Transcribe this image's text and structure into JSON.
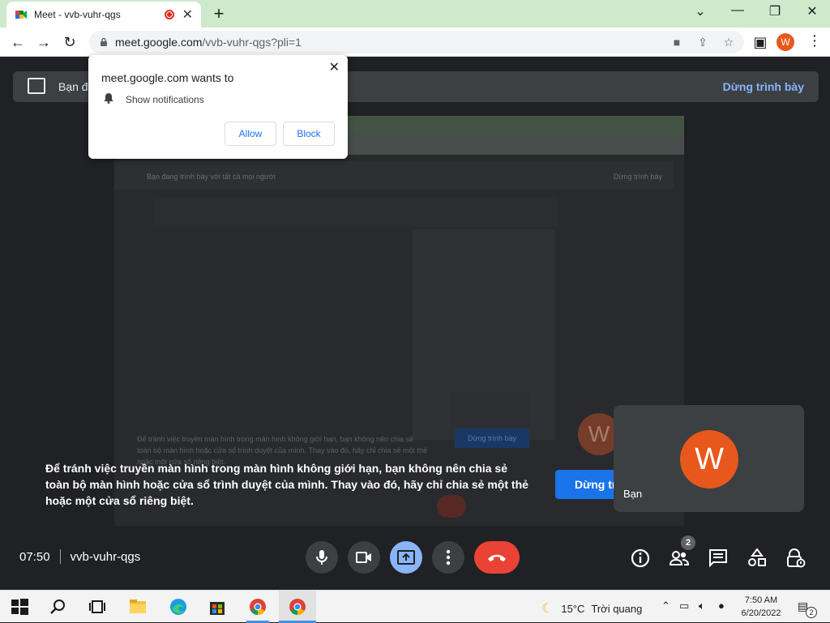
{
  "browser": {
    "tab_title": "Meet - vvb-vuhr-qgs",
    "url_host": "meet.google.com",
    "url_path": "/vvb-vuhr-qgs?pli=1",
    "profile_initial": "W"
  },
  "banner": {
    "text": "Bạn đ",
    "stop_label": "Dừng trình bày"
  },
  "mirror": {
    "banner_text": "Bạn đang trình bày với tất cả mọi người",
    "banner_stop": "Dừng trình bày",
    "message": "Để tránh việc truyền màn hình trong màn hình không giới hạn, bạn không nên chia sẻ toàn bộ màn hình hoặc cửa sổ trình duyệt của mình. Thay vào đó, hãy chỉ chia sẻ một thẻ hoặc một cửa sổ riêng biệt.",
    "button": "Dừng trình bày",
    "avatar": "W",
    "you": "Bạn"
  },
  "notice": "Để tránh việc truyền màn hình trong màn hình không giới hạn, bạn không nên chia sẻ toàn bộ màn hình hoặc cửa sổ trình duyệt của mình. Thay vào đó, hãy chỉ chia sẻ một thẻ hoặc một cửa sổ riêng biệt.",
  "stop_button_partial": "Dừng tr",
  "self_tile": {
    "initial": "W",
    "name": "Bạn"
  },
  "meeting": {
    "time": "07:50",
    "code": "vvb-vuhr-qgs",
    "participants_count": "2"
  },
  "popup": {
    "title": "meet.google.com wants to",
    "permission": "Show notifications",
    "allow_label": "Allow",
    "block_label": "Block"
  },
  "taskbar": {
    "temperature": "15°C",
    "weather": "Trời quang",
    "time": "7:50 AM",
    "date": "6/20/2022",
    "notification_count": "2"
  },
  "colors": {
    "meet_bg": "#202124",
    "accent_blue": "#1a73e8",
    "hangup_red": "#ea4335",
    "avatar_orange": "#e8581c",
    "tab_strip": "#cfe9cc"
  }
}
